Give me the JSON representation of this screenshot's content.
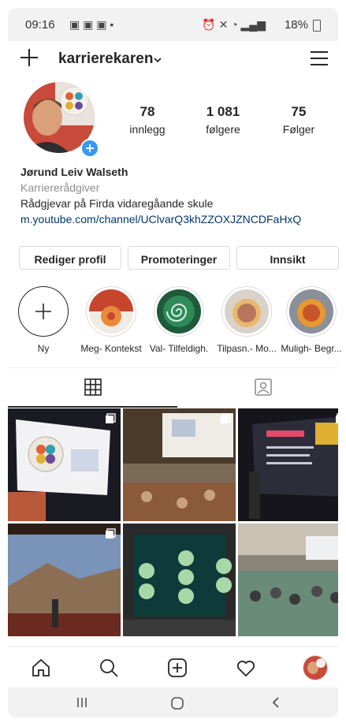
{
  "status": {
    "time": "09:16",
    "right": "18%"
  },
  "header": {
    "username": "karrierekaren"
  },
  "stats": [
    {
      "value": "78",
      "label": "innlegg"
    },
    {
      "value": "1 081",
      "label": "følgere"
    },
    {
      "value": "75",
      "label": "Følger"
    }
  ],
  "bio": {
    "name": "Jørund Leiv Walseth",
    "category": "Karriererådgiver",
    "description": "Rådgjevar på Firda vidaregåande skule",
    "link": "m.youtube.com/channel/UClvarQ3khZZOXJZNCDFaHxQ"
  },
  "buttons": {
    "edit": "Rediger profil",
    "promo": "Promoteringer",
    "insight": "Innsikt"
  },
  "highlights": [
    {
      "label": "Ny"
    },
    {
      "label": "Meg- Kontekst"
    },
    {
      "label": "Val- Tilfeldigh."
    },
    {
      "label": "Tilpasn.- Mo..."
    },
    {
      "label": "Muligh- Begr..."
    }
  ],
  "grid_posts": [
    {
      "screen_text": ""
    },
    {
      "screen_text": ""
    },
    {
      "screen_text": ""
    },
    {
      "screen_text": ""
    },
    {
      "screen_text": ""
    },
    {
      "screen_text": ""
    }
  ],
  "colors": {
    "accent": "#3897f0",
    "link": "#00376b",
    "muted": "#8e8e8e"
  }
}
